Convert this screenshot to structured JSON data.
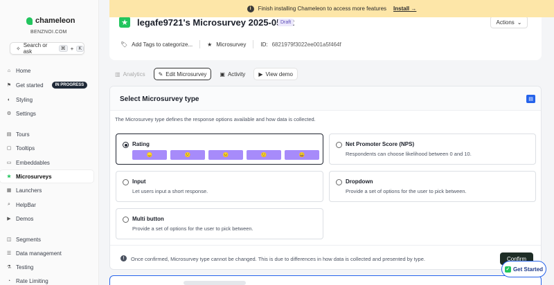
{
  "banner": {
    "message": "Finish installing Chameleon to access more features",
    "install_label": "Install →"
  },
  "brand": {
    "name": "chameleon",
    "workspace": "BENZNOI.COM"
  },
  "search": {
    "label": "Search or ask",
    "kbd1": "⌘",
    "plus": "+",
    "kbd2": "K"
  },
  "nav": [
    {
      "label": "Home",
      "icon": "home-icon",
      "glyph": "⌂"
    },
    {
      "label": "Get started",
      "icon": "flag-icon",
      "glyph": "⚑",
      "badge": "IN PROGRESS"
    },
    {
      "label": "Styling",
      "icon": "paint-icon",
      "glyph": "◐"
    },
    {
      "label": "Settings",
      "icon": "gear-icon",
      "glyph": "⚙"
    },
    {
      "label": "Tours",
      "icon": "tours-icon",
      "glyph": "▤"
    },
    {
      "label": "Tooltips",
      "icon": "tooltip-icon",
      "glyph": "▢"
    },
    {
      "label": "Embeddables",
      "icon": "embed-icon",
      "glyph": "▭"
    },
    {
      "label": "Microsurveys",
      "icon": "star-icon",
      "glyph": "★",
      "active": true
    },
    {
      "label": "Launchers",
      "icon": "launcher-icon",
      "glyph": "▦"
    },
    {
      "label": "HelpBar",
      "icon": "helpbar-icon",
      "glyph": "⌕"
    },
    {
      "label": "Demos",
      "icon": "demo-icon",
      "glyph": "▶"
    },
    {
      "label": "Segments",
      "icon": "segments-icon",
      "glyph": "◫"
    },
    {
      "label": "Data management",
      "icon": "database-icon",
      "glyph": "☰"
    },
    {
      "label": "Testing",
      "icon": "testing-icon",
      "glyph": "⚗"
    },
    {
      "label": "Rate Limiting",
      "icon": "rate-icon",
      "glyph": "◔"
    }
  ],
  "header": {
    "title": "legafe9721's Microsurvey 2025-05-12",
    "draft": "Draft",
    "actions_label": "Actions",
    "add_tags": "Add Tags to categorize...",
    "type_label": "Microsurvey",
    "id_label": "ID:",
    "id_value": "6821979f3022ee001a5f464f"
  },
  "tabs": [
    {
      "label": "Analytics",
      "icon": "analytics-icon",
      "glyph": "▥"
    },
    {
      "label": "Edit Microsurvey",
      "icon": "edit-icon",
      "glyph": "✎"
    },
    {
      "label": "Activity",
      "icon": "activity-icon",
      "glyph": "▣"
    },
    {
      "label": "View demo",
      "icon": "play-icon",
      "glyph": "▶"
    }
  ],
  "main": {
    "title": "Select Microsurvey type",
    "description": "The Microsurvey type defines the response options available and how data is collected.",
    "options": [
      {
        "title": "Rating",
        "description": ""
      },
      {
        "title": "Net Promoter Score (NPS)",
        "description": "Respondents can choose likelihood between 0 and 10."
      },
      {
        "title": "Input",
        "description": "Let users input a short response."
      },
      {
        "title": "Dropdown",
        "description": "Provide a set of options for the user to pick between."
      },
      {
        "title": "Multi button",
        "description": "Provide a set of options for the user to pick between."
      }
    ],
    "rating_emojis": [
      "😞",
      "😕",
      "😐",
      "🙂",
      "😄"
    ],
    "footnote": "Once confirmed, Microsurvey type cannot be changed. This is due to differences in how data is collected and presented by type.",
    "confirm_label": "Confirm"
  },
  "get_started_label": "Get Started",
  "colors": {
    "accent": "#22c55e",
    "banner": "#fde6a8",
    "rating_button": "#a78bfa",
    "focus": "#2563eb"
  }
}
